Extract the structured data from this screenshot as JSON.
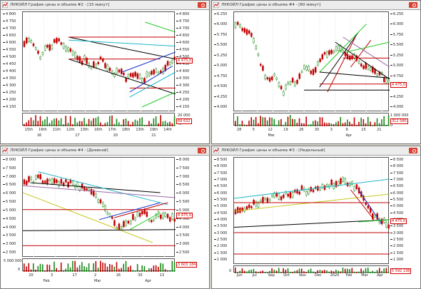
{
  "windows": [
    {
      "title": "ЛУКОЙЛ График цены и объема #2 - [15 минут]",
      "y_ticks": [
        "4 800",
        "4 750",
        "4 700",
        "4 650",
        "4 600",
        "4 550",
        "4 500",
        "4 450",
        "4 400",
        "4 350",
        "4 300",
        "4 250",
        "4 200",
        "4 150"
      ],
      "last_price": "4 475,0",
      "volume_ticks": [
        "20 000"
      ],
      "volume_zero": "0",
      "volume_last": "69 632",
      "x_top": [
        "15th",
        "16th",
        "11th",
        "12th",
        "13th",
        "16th",
        "17th",
        "18th",
        "13th",
        "19th",
        "14th"
      ],
      "x_bottom": [
        "16",
        "17",
        "20",
        "21"
      ],
      "y_range": [
        4120,
        4820
      ]
    },
    {
      "title": "ЛУКОЙЛ График цены и объема #4 - [60 минут]",
      "y_ticks": [
        "6.250",
        "6.000",
        "5.750",
        "5.500",
        "5.250",
        "5.000",
        "4.750",
        "4.500",
        "4.250",
        "4.000"
      ],
      "last_price": "4 475,0",
      "volume_ticks": [
        "1 000 000"
      ],
      "volume_zero": "0",
      "volume_last": "312 580",
      "x_top": [
        "28",
        "5",
        "12",
        "19",
        "26",
        "30",
        "3",
        "9",
        "15",
        "21"
      ],
      "x_bottom": [
        "Mar",
        "Apr"
      ],
      "y_range": [
        3900,
        6350
      ]
    },
    {
      "title": "ЛУКОЙЛ График цены и объема #4 - [Дневной]",
      "y_ticks": [
        "8 000",
        "7 500",
        "7 000",
        "6 500",
        "6 000",
        "5 500",
        "5 000",
        "4 500",
        "4 000",
        "3 500",
        "3 000",
        "2 500"
      ],
      "last_price": "4 475,0",
      "volume_ticks": [
        "5 000 000"
      ],
      "volume_zero": "0",
      "volume_last": "3 603 184",
      "x_top": [
        "20",
        "3",
        "17",
        "2",
        "16",
        "30",
        "13"
      ],
      "x_bottom": [
        "Feb",
        "Mar",
        "Apr"
      ],
      "y_range": [
        2300,
        8100
      ]
    },
    {
      "title": "ЛУКОЙЛ График цены и объема #3 - [Недельный]",
      "y_ticks": [
        "8 500",
        "8 000",
        "7 500",
        "7 000",
        "6 500",
        "6 000",
        "5 500",
        "5 000",
        "4 500",
        "4 000",
        "3 500",
        "3 000",
        "2 500",
        "2 000",
        "1 500",
        "1 000"
      ],
      "last_price": "4 475,0",
      "volume_ticks": [
        "0"
      ],
      "volume_zero": "0",
      "volume_last": "5 592 136",
      "x_top": [
        "Jun",
        "Jul",
        "Sep",
        "Oct",
        "Nov",
        "Dec",
        "2020",
        "Feb",
        "Mar",
        "Apr"
      ],
      "x_bottom": [],
      "y_range": [
        900,
        8700
      ]
    }
  ],
  "colors": {
    "bg": "#d4d0c8",
    "up": "#1a8a1a",
    "down": "#c00000",
    "trend_red": "#c00000",
    "trend_black": "#000000",
    "trend_cyan": "#20b8c8",
    "trend_green": "#22cc22",
    "trend_yellow": "#c8c820",
    "trend_blue": "#1530c8",
    "trend_purple": "#9a6aa8"
  },
  "icons": [
    "chart-window-icon",
    "close-icon"
  ]
}
